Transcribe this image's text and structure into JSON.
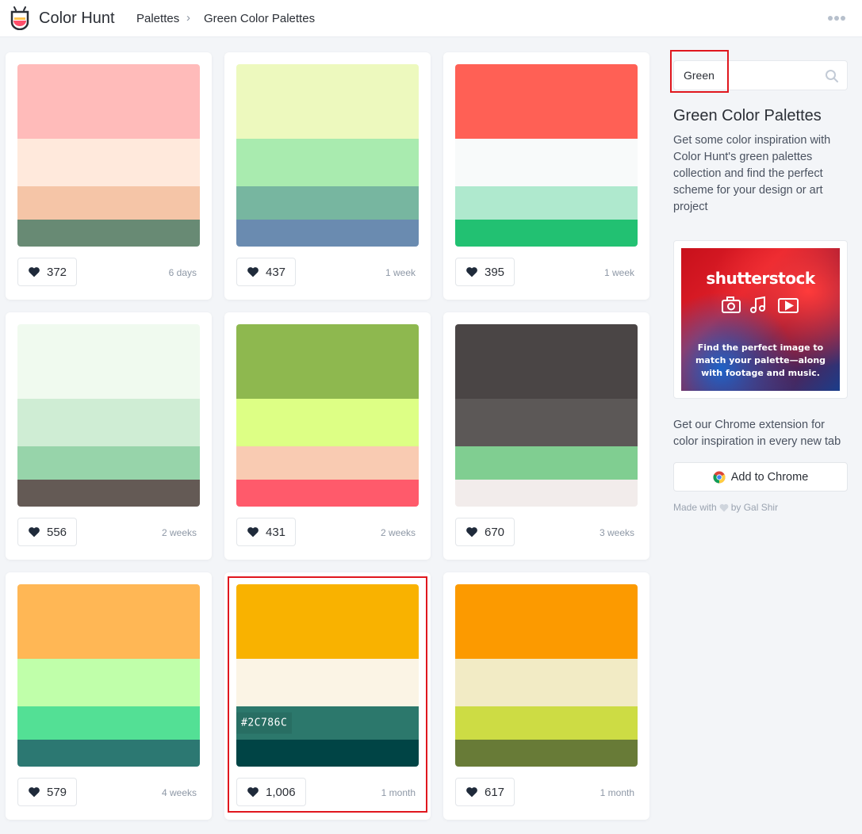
{
  "header": {
    "app_title": "Color Hunt",
    "breadcrumbs": [
      "Palettes",
      "Green Color Palettes"
    ],
    "separator": "›"
  },
  "palettes": [
    {
      "colors": [
        "#FFBBBA",
        "#FFE9DC",
        "#F5C5A7",
        "#688A74"
      ],
      "likes": "372",
      "age": "6 days"
    },
    {
      "colors": [
        "#EDF9BE",
        "#A9EBAF",
        "#77B6A0",
        "#6A8BB0"
      ],
      "likes": "437",
      "age": "1 week"
    },
    {
      "colors": [
        "#FF6055",
        "#F8FAFA",
        "#AFE9CE",
        "#22C172"
      ],
      "likes": "395",
      "age": "1 week"
    },
    {
      "colors": [
        "#F0FAEF",
        "#CFEDD4",
        "#97D4AA",
        "#645A55"
      ],
      "likes": "556",
      "age": "2 weeks"
    },
    {
      "colors": [
        "#8EB84F",
        "#DDFF85",
        "#F9CBB2",
        "#FF5A6B"
      ],
      "likes": "431",
      "age": "2 weeks"
    },
    {
      "colors": [
        "#4A4545",
        "#5C5857",
        "#80CE91",
        "#F2ECEB"
      ],
      "likes": "670",
      "age": "3 weeks"
    },
    {
      "colors": [
        "#FFB755",
        "#C0FFAA",
        "#53E095",
        "#2C7872"
      ],
      "likes": "579",
      "age": "4 weeks"
    },
    {
      "colors": [
        "#F9B200",
        "#FBF4E5",
        "#2C786C",
        "#004445"
      ],
      "likes": "1,006",
      "age": "1 month",
      "hovered_hex": "#2C786C"
    },
    {
      "colors": [
        "#FC9A00",
        "#F2EBC5",
        "#CDDC44",
        "#687B37"
      ],
      "likes": "617",
      "age": "1 month"
    }
  ],
  "sidebar": {
    "search_value": "Green",
    "title": "Green Color Palettes",
    "description": "Get some color inspiration with Color Hunt's green palettes collection and find the perfect scheme for your design or art project",
    "ad": {
      "brand": "shutterstock",
      "text": "Find the perfect image to match your palette—along with footage and music."
    },
    "extension_text": "Get our Chrome extension for color inspiration in every new tab",
    "chrome_button": "Add to Chrome",
    "credit_prefix": "Made with",
    "credit_suffix": "by Gal Shir"
  },
  "colors": {
    "highlight": "#E0171E",
    "heart": "#1F2A3A"
  }
}
